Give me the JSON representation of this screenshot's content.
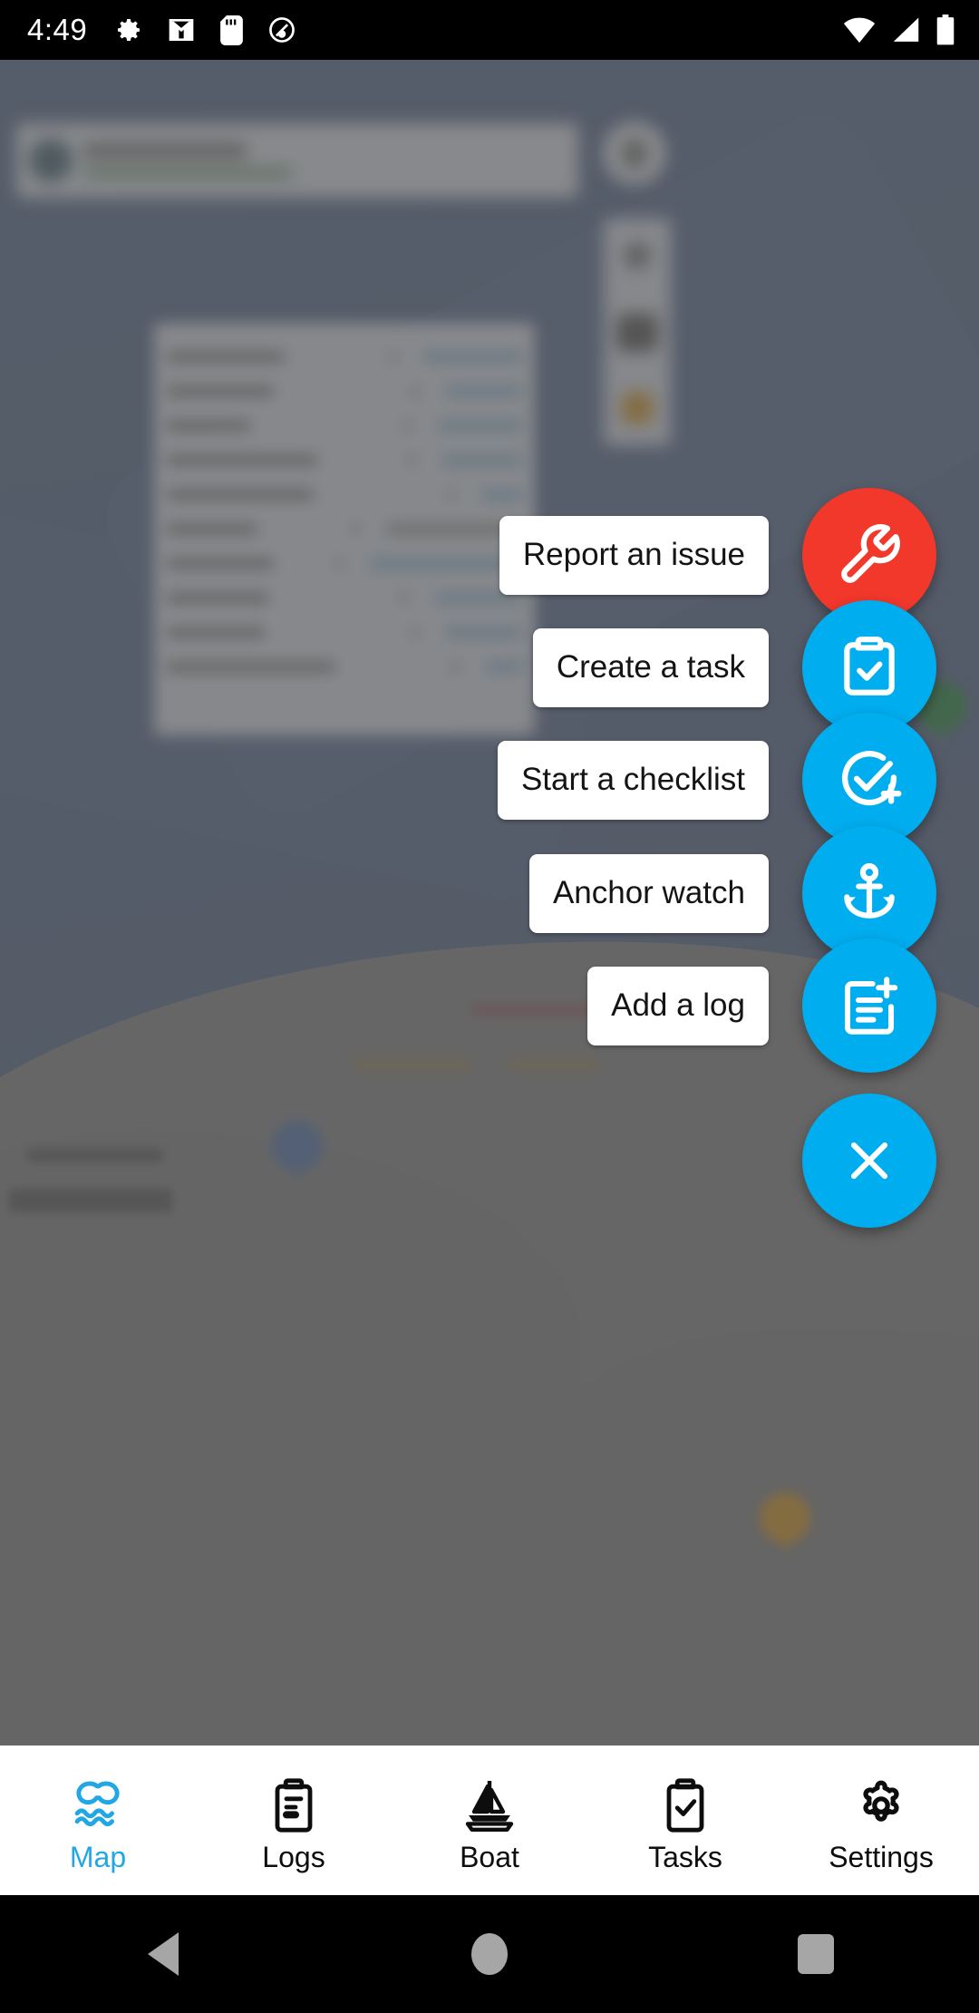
{
  "status_bar": {
    "time": "4:49",
    "left_icons": [
      "gear-icon",
      "gmail-icon",
      "sd-card-icon",
      "location-off-icon"
    ],
    "right_icons": [
      "wifi-icon",
      "cellular-signal-icon",
      "battery-full-icon"
    ],
    "background": "#000000",
    "foreground": "#ffffff"
  },
  "colors": {
    "accent_blue": "#00ADEF",
    "issue_red": "#F2372B",
    "nav_active": "#21A8E4",
    "nav_inactive": "#0D0D0D",
    "scrim": "rgba(90,90,90,0.62)",
    "water": "#4F6182",
    "land": "#7A7A7A",
    "label_bg": "#FFFFFF",
    "label_text": "#141414"
  },
  "fab_menu": {
    "open": true,
    "actions": [
      {
        "label": "Report an issue",
        "icon": "wrench-icon",
        "color": "#F2372B",
        "name": "report-issue"
      },
      {
        "label": "Create a task",
        "icon": "clipboard-check-icon",
        "color": "#00ADEF",
        "name": "create-task"
      },
      {
        "label": "Start a checklist",
        "icon": "check-circle-plus-icon",
        "color": "#00ADEF",
        "name": "start-checklist"
      },
      {
        "label": "Anchor watch",
        "icon": "anchor-icon",
        "color": "#00ADEF",
        "name": "anchor-watch"
      },
      {
        "label": "Add a log",
        "icon": "note-add-icon",
        "color": "#00ADEF",
        "name": "add-log"
      }
    ],
    "close": {
      "icon": "close-icon",
      "color": "#00ADEF",
      "name": "close-fab-menu"
    }
  },
  "bottom_nav": {
    "items": [
      {
        "label": "Map",
        "icon": "map-waves-icon",
        "active": true
      },
      {
        "label": "Logs",
        "icon": "logbook-icon",
        "active": false
      },
      {
        "label": "Boat",
        "icon": "sailboat-icon",
        "active": false
      },
      {
        "label": "Tasks",
        "icon": "clipboard-check-icon",
        "active": false
      },
      {
        "label": "Settings",
        "icon": "gear-icon",
        "active": false
      }
    ]
  },
  "android_nav": {
    "buttons": [
      {
        "name": "back-button",
        "icon": "triangle-back-icon"
      },
      {
        "name": "home-button",
        "icon": "circle-home-icon"
      },
      {
        "name": "recents-button",
        "icon": "square-recents-icon"
      }
    ]
  },
  "map_background": {
    "description_visible": false,
    "blurred": true,
    "markers": [
      {
        "color": "#B03050",
        "name": "map-pin-red"
      },
      {
        "color": "#1E7B35",
        "name": "map-pin-green"
      },
      {
        "color": "#B03050",
        "name": "map-pin-red-2"
      },
      {
        "color": "#C8891A",
        "name": "map-pin-orange"
      },
      {
        "color": "#4A6AA0",
        "name": "map-pin-blue"
      }
    ],
    "toolbar_icons": [
      "compass-icon",
      "layers-icon",
      "warning-icon"
    ]
  }
}
